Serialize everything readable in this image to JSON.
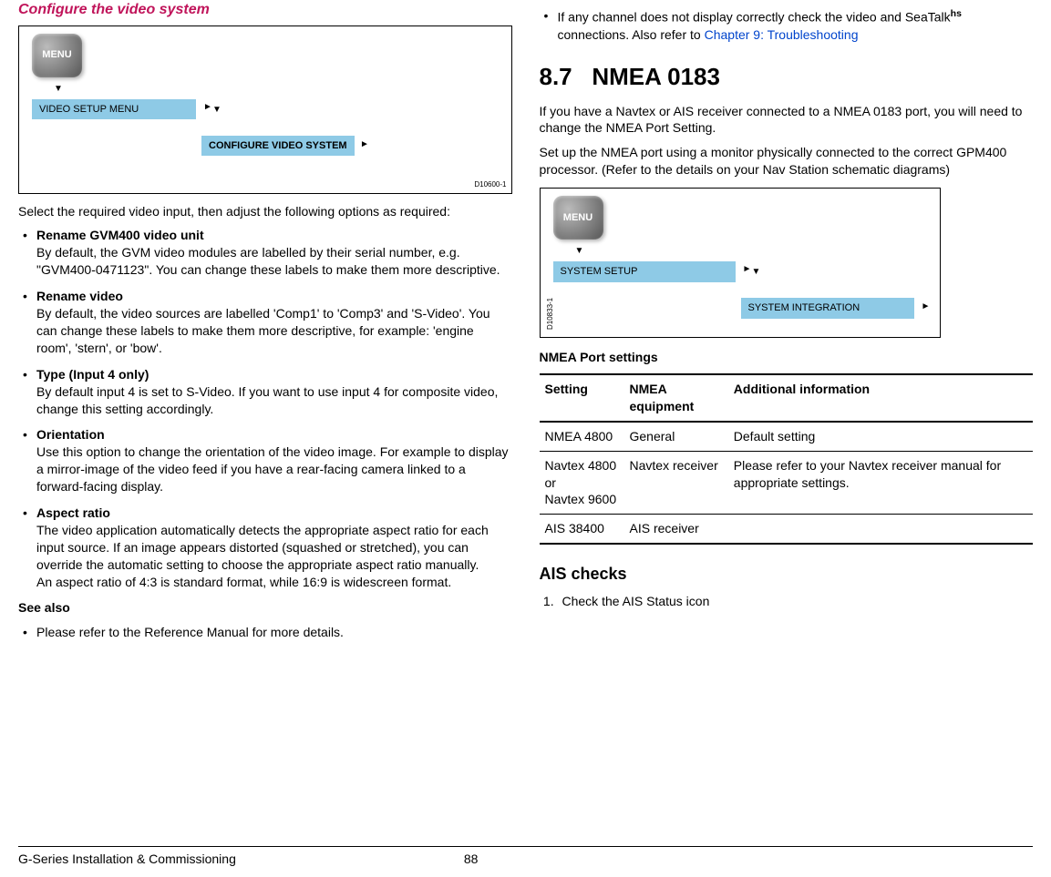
{
  "left": {
    "section_title": "Configure the video system",
    "diagram": {
      "menu_label": "MENU",
      "box1": "VIDEO SETUP MENU",
      "box2": "CONFIGURE VIDEO SYSTEM",
      "id": "D10600-1"
    },
    "intro": "Select the required video input, then adjust the following options as required:",
    "items": [
      {
        "title": "Rename GVM400 video unit",
        "body": "By default, the GVM video modules are labelled by their serial number, e.g.  \"GVM400-0471123\". You can change these labels to make them more descriptive."
      },
      {
        "title": "Rename video",
        "body": "By default, the video sources are labelled 'Comp1' to 'Comp3' and 'S-Video'. You can change these labels to make them more descriptive, for example: 'engine room', 'stern', or 'bow'."
      },
      {
        "title": "Type (Input 4 only)",
        "body": "By default input 4 is set to S-Video. If you want to use input 4 for composite video, change this setting accordingly."
      },
      {
        "title": "Orientation",
        "body": "Use this option to change the orientation of the video image. For example to display a mirror-image of the video feed if you have a rear-facing camera linked to a forward-facing display."
      },
      {
        "title": "Aspect ratio",
        "body": "The video application automatically detects the appropriate aspect ratio for each input source. If an image appears distorted (squashed or stretched), you can override the automatic setting to choose the appropriate aspect ratio manually.\nAn aspect ratio of 4:3 is standard format, while 16:9 is widescreen format."
      }
    ],
    "see_also_label": "See also",
    "see_also_item": "Please refer to the Reference Manual for more details."
  },
  "right": {
    "bullet_prefix": "If any channel does not display correctly check the video and SeaTalk",
    "bullet_sup": "hs",
    "bullet_after": " connections. Also refer to ",
    "bullet_link": "Chapter 9: Troubleshooting",
    "h2_num": "8.7",
    "h2_title": "NMEA 0183",
    "para1": "If you have a Navtex or AIS receiver connected to a NMEA 0183 port, you will need to change the NMEA Port Setting.",
    "para2": "Set up the NMEA port using a monitor physically connected to the correct GPM400 processor. (Refer to the details on your Nav Station schematic diagrams)",
    "diagram": {
      "menu_label": "MENU",
      "box1": "SYSTEM SETUP",
      "box2": "SYSTEM INTEGRATION",
      "id": "D10833-1"
    },
    "table_title": "NMEA Port settings",
    "table": {
      "headers": [
        "Setting",
        "NMEA equipment",
        "Additional information"
      ],
      "rows": [
        [
          "NMEA 4800",
          "General",
          "Default setting"
        ],
        [
          "Navtex 4800 or\nNavtex 9600",
          "Navtex receiver",
          "Please refer to your Navtex receiver manual for appropriate settings."
        ],
        [
          "AIS 38400",
          "AIS receiver",
          ""
        ]
      ]
    },
    "h3": "AIS checks",
    "ol_item": "Check the AIS Status icon"
  },
  "footer": {
    "left": "G-Series Installation & Commissioning",
    "page": "88"
  }
}
